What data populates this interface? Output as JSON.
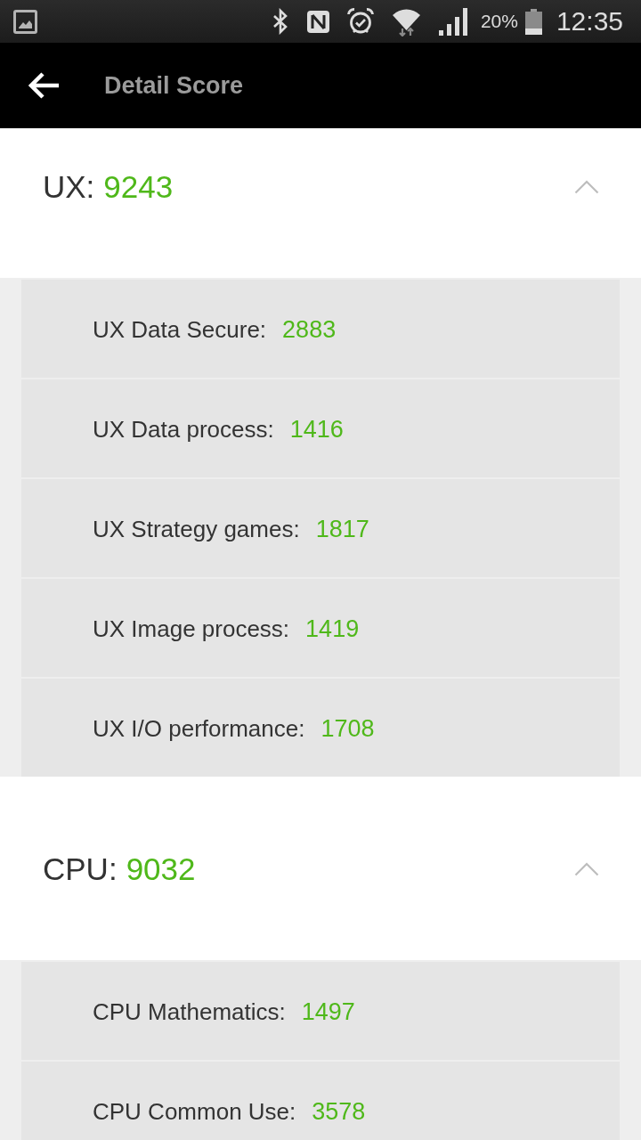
{
  "status_bar": {
    "battery": "20%",
    "time": "12:35"
  },
  "app_bar": {
    "title": "Detail Score"
  },
  "sections": [
    {
      "label": "UX:",
      "score": "9243",
      "expanded": true,
      "items": [
        {
          "label": "UX Data Secure:",
          "score": "2883"
        },
        {
          "label": "UX Data process:",
          "score": "1416"
        },
        {
          "label": "UX Strategy games:",
          "score": "1817"
        },
        {
          "label": "UX Image process:",
          "score": "1419"
        },
        {
          "label": "UX I/O performance:",
          "score": "1708"
        }
      ]
    },
    {
      "label": "CPU:",
      "score": "9032",
      "expanded": true,
      "items": [
        {
          "label": "CPU Mathematics:",
          "score": "1497"
        },
        {
          "label": "CPU Common Use:",
          "score": "3578"
        }
      ]
    }
  ]
}
